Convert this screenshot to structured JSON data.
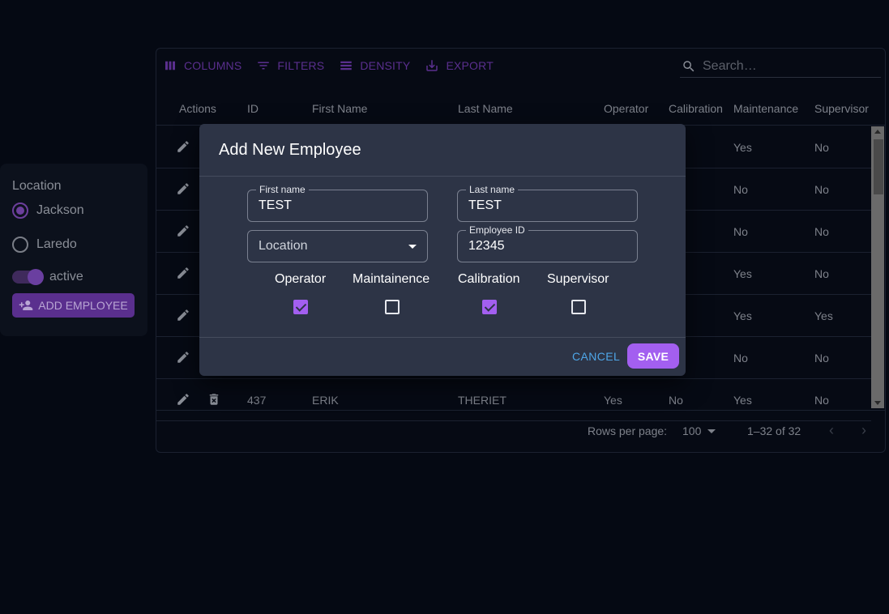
{
  "left_panel": {
    "title": "Location",
    "options": [
      {
        "label": "Jackson",
        "selected": true
      },
      {
        "label": "Laredo",
        "selected": false
      }
    ],
    "toggle_label": "active",
    "toggle_on": true,
    "add_button_label": "ADD EMPLOYEE"
  },
  "toolbar": {
    "columns_label": "COLUMNS",
    "filters_label": "FILTERS",
    "density_label": "DENSITY",
    "export_label": "EXPORT",
    "search_placeholder": "Search…"
  },
  "grid": {
    "headers": [
      "Actions",
      "ID",
      "First Name",
      "Last Name",
      "Operator",
      "Calibration",
      "Maintenance",
      "Supervisor"
    ],
    "rows": [
      {
        "id": "",
        "first": "",
        "last": "",
        "operator": "",
        "calibration": "s",
        "maintenance": "Yes",
        "supervisor": "No"
      },
      {
        "id": "",
        "first": "",
        "last": "",
        "operator": "",
        "calibration": "",
        "maintenance": "No",
        "supervisor": "No"
      },
      {
        "id": "",
        "first": "",
        "last": "",
        "operator": "",
        "calibration": "",
        "maintenance": "No",
        "supervisor": "No"
      },
      {
        "id": "",
        "first": "",
        "last": "",
        "operator": "",
        "calibration": "",
        "maintenance": "Yes",
        "supervisor": "No"
      },
      {
        "id": "",
        "first": "",
        "last": "",
        "operator": "",
        "calibration": "s",
        "maintenance": "Yes",
        "supervisor": "Yes"
      },
      {
        "id": "",
        "first": "",
        "last": "",
        "operator": "",
        "calibration": "s",
        "maintenance": "No",
        "supervisor": "No"
      },
      {
        "id": "437",
        "first": "ERIK",
        "last": "THERIET",
        "operator": "Yes",
        "calibration": "No",
        "maintenance": "Yes",
        "supervisor": "No"
      }
    ],
    "footer": {
      "rows_per_page_label": "Rows per page:",
      "rows_per_page_value": "100",
      "range_text": "1–32 of 32"
    }
  },
  "dialog": {
    "title": "Add New Employee",
    "first_name_label": "First name",
    "first_name_value": "TEST",
    "last_name_label": "Last name",
    "last_name_value": "TEST",
    "location_placeholder": "Location",
    "employee_id_label": "Employee ID",
    "employee_id_value": "12345",
    "checkboxes": [
      {
        "label": "Operator",
        "checked": true
      },
      {
        "label": "Maintainence",
        "checked": false
      },
      {
        "label": "Calibration",
        "checked": true
      },
      {
        "label": "Supervisor",
        "checked": false
      }
    ],
    "cancel_label": "CANCEL",
    "save_label": "SAVE"
  },
  "colors": {
    "accent": "#a35ff0",
    "dim_accent": "#5a2f8e",
    "dialog_bg": "#2d3446",
    "page_bg": "#050913",
    "cancel_link": "#4ea6e8"
  }
}
